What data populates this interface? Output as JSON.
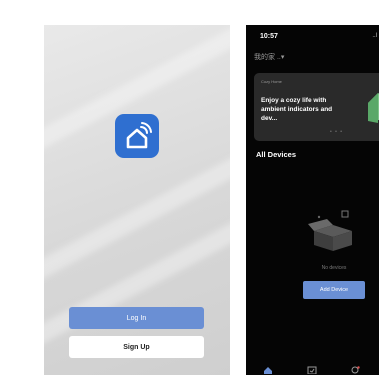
{
  "left": {
    "login_label": "Log In",
    "signup_label": "Sign Up",
    "app_icon": "smart-home-wifi-icon",
    "colors": {
      "accent": "#6a8fd4",
      "icon_bg": "#2f6fd0"
    }
  },
  "right": {
    "status_time": "10:57",
    "status_indicator": "..l",
    "home_name": "我的家 ..▾",
    "banner": {
      "tag": "Cozy Home",
      "text": "Enjoy a cozy life with ambient indicators and dev...",
      "dots": "• • •"
    },
    "section_title": "All Devices",
    "empty_text": "No devices",
    "add_button": "Add Device",
    "tabs": [
      {
        "icon": "home-tab-icon",
        "active": true
      },
      {
        "icon": "scene-tab-icon",
        "active": false
      },
      {
        "icon": "profile-tab-icon",
        "active": false
      }
    ],
    "colors": {
      "bg": "#050505",
      "card": "#2a2a2a",
      "accent": "#6a8fd4"
    }
  }
}
